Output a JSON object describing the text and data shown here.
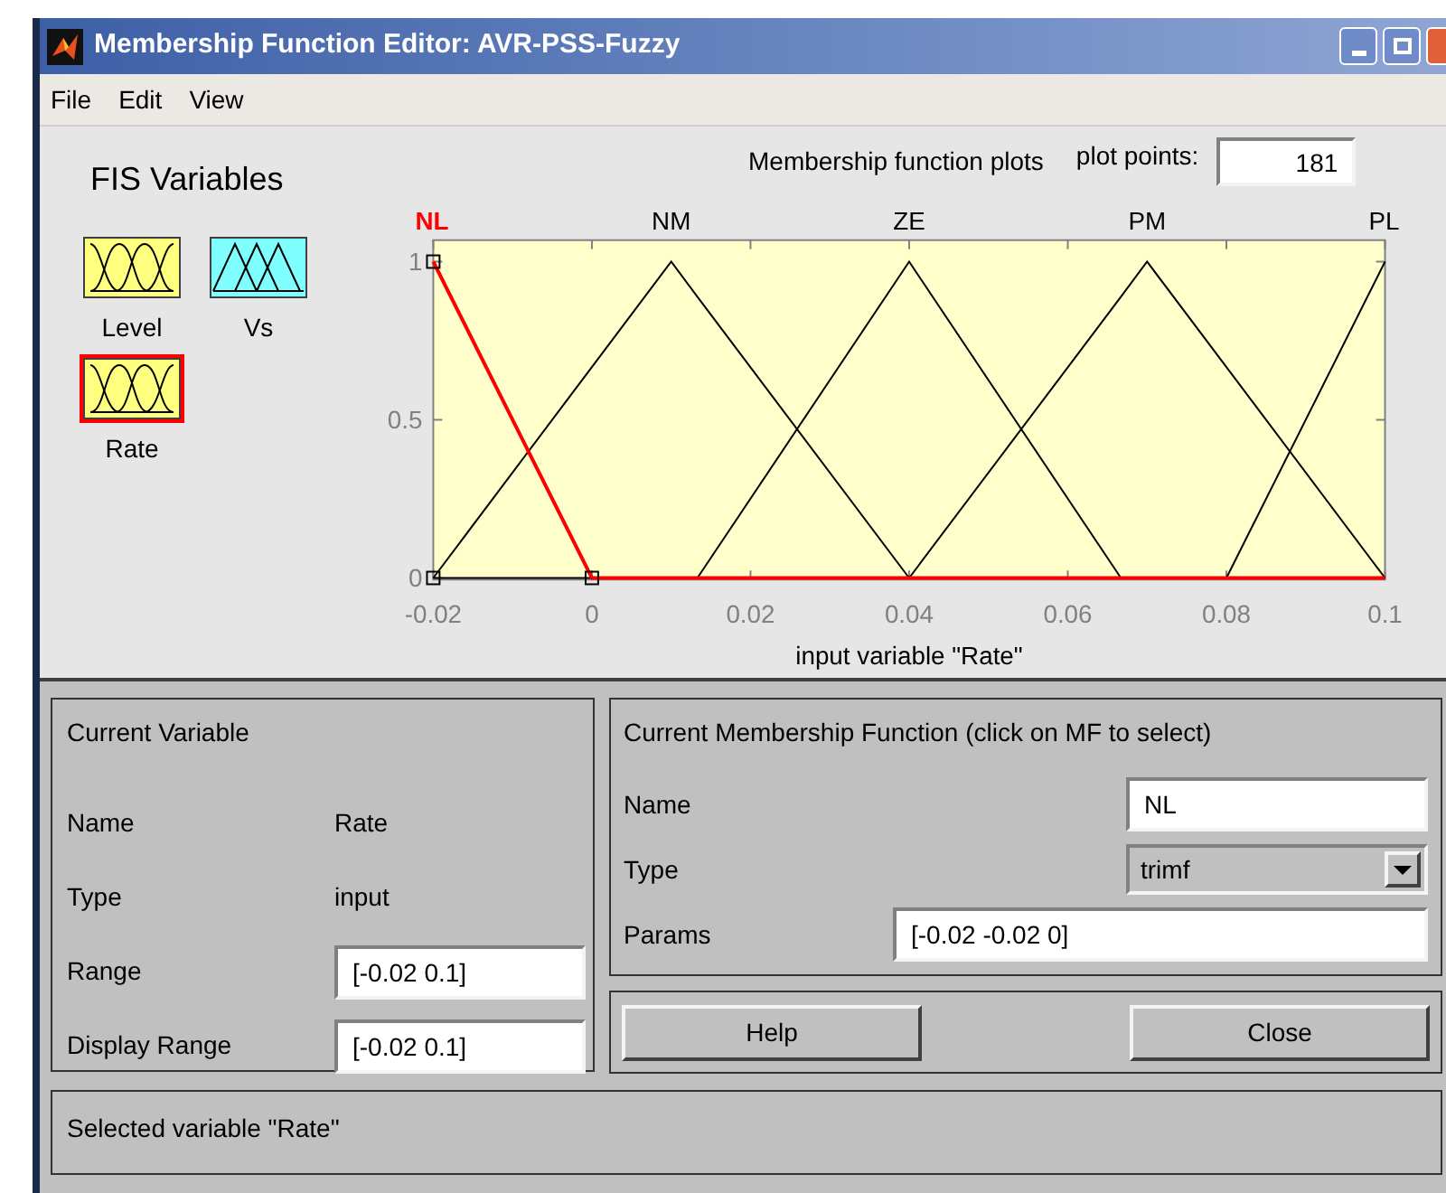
{
  "window": {
    "title": "Membership Function Editor: AVR-PSS-Fuzzy"
  },
  "menu": [
    {
      "label": "File"
    },
    {
      "label": "Edit"
    },
    {
      "label": "View"
    }
  ],
  "fis_variables": {
    "title": "FIS Variables",
    "items": [
      {
        "label": "Level",
        "kind": "input",
        "selected": false
      },
      {
        "label": "Vs",
        "kind": "output",
        "selected": false
      },
      {
        "label": "Rate",
        "kind": "input",
        "selected": true
      }
    ]
  },
  "plot": {
    "title": "Membership function plots",
    "plot_points_label": "plot points:",
    "plot_points": "181",
    "chart_data": {
      "type": "line",
      "xlabel": "input variable \"Rate\"",
      "x": [
        -0.02,
        0,
        0.01,
        0.0133,
        0.04,
        0.0667,
        0.07,
        0.08,
        0.1
      ],
      "xlim": [
        -0.02,
        0.1
      ],
      "ylim": [
        -0.005,
        1.068
      ],
      "xticks": [
        {
          "value": -0.02,
          "label": "-0.02"
        },
        {
          "value": 0,
          "label": "0"
        },
        {
          "value": 0.02,
          "label": "0.02"
        },
        {
          "value": 0.04,
          "label": "0.04"
        },
        {
          "value": 0.06,
          "label": "0.06"
        },
        {
          "value": 0.08,
          "label": "0.08"
        },
        {
          "value": 0.1,
          "label": "0.1"
        }
      ],
      "yticks": [
        {
          "value": 0,
          "label": "0"
        },
        {
          "value": 0.5,
          "label": "0.5"
        },
        {
          "value": 1,
          "label": "1"
        }
      ],
      "series": [
        {
          "name": "NL",
          "values": [
            1,
            0,
            0,
            0,
            0,
            0,
            0,
            0,
            0
          ]
        },
        {
          "name": "NM",
          "values": [
            0,
            0.667,
            1,
            0.889,
            0,
            null,
            null,
            null,
            null
          ]
        },
        {
          "name": "ZE",
          "values": [
            null,
            null,
            null,
            0,
            1,
            0,
            null,
            null,
            null
          ]
        },
        {
          "name": "PM",
          "values": [
            null,
            null,
            null,
            null,
            0,
            0.889,
            1,
            0.667,
            0
          ]
        },
        {
          "name": "PL",
          "values": [
            null,
            null,
            null,
            null,
            null,
            null,
            null,
            0,
            1
          ]
        }
      ]
    },
    "functions": [
      {
        "selected": true
      },
      {
        "selected": false
      },
      {
        "selected": false
      },
      {
        "selected": false
      },
      {
        "selected": false
      }
    ]
  },
  "current_variable": {
    "title": "Current Variable",
    "name_label": "Name",
    "name": "Rate",
    "type_label": "Type",
    "type": "input",
    "range_label": "Range",
    "range": "[-0.02 0.1]",
    "display_range_label": "Display Range",
    "display_range": "[-0.02 0.1]"
  },
  "current_mf": {
    "title": "Current Membership Function (click on MF to select)",
    "name_label": "Name",
    "name": "NL",
    "type_label": "Type",
    "type": "trimf",
    "params_label": "Params",
    "params": "[-0.02 -0.02 0]"
  },
  "buttons": [
    {
      "label": "Help"
    },
    {
      "label": "Close"
    }
  ],
  "status": "Selected variable \"Rate\""
}
